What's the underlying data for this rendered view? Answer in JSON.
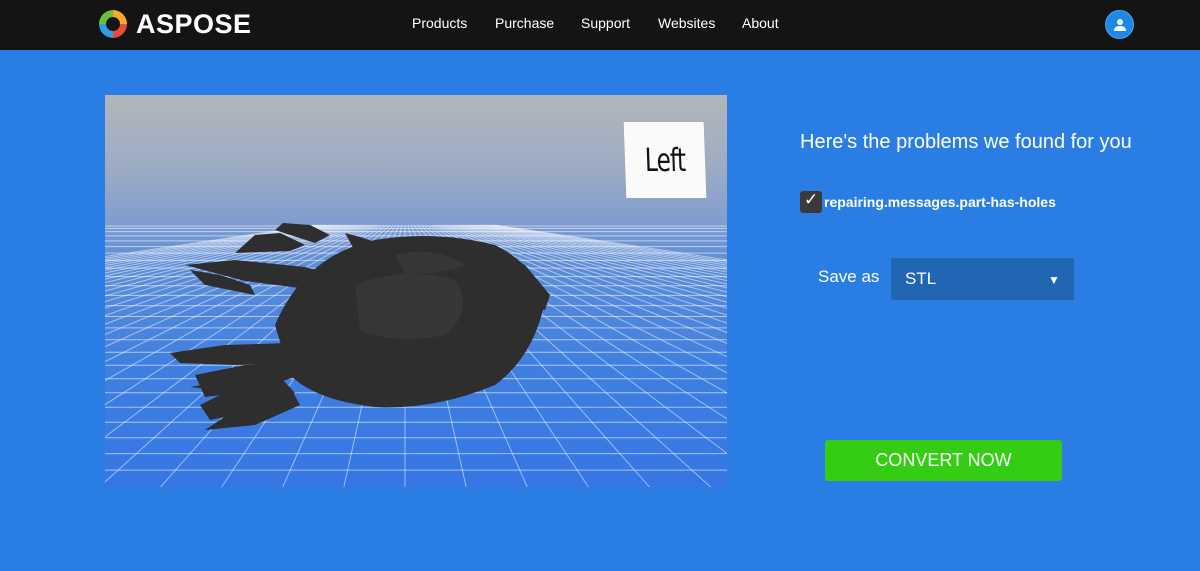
{
  "brand": {
    "name": "ASPOSE"
  },
  "nav": {
    "items": [
      "Products",
      "Purchase",
      "Support",
      "Websites",
      "About"
    ]
  },
  "viewer": {
    "cube_face_label": "Left",
    "model": "spaceship-3d-model"
  },
  "panel": {
    "title": "Here's the problems we found for you",
    "issues": [
      {
        "label": "repairing.messages.part-has-holes",
        "checked": true
      }
    ],
    "save_as_label": "Save as",
    "format_selected": "STL",
    "convert_label": "CONVERT NOW"
  },
  "colors": {
    "background": "#2a7ee3",
    "topbar": "#141414",
    "select": "#2166b3",
    "convert_button": "#35cc14",
    "model": "#2e2e2e"
  }
}
